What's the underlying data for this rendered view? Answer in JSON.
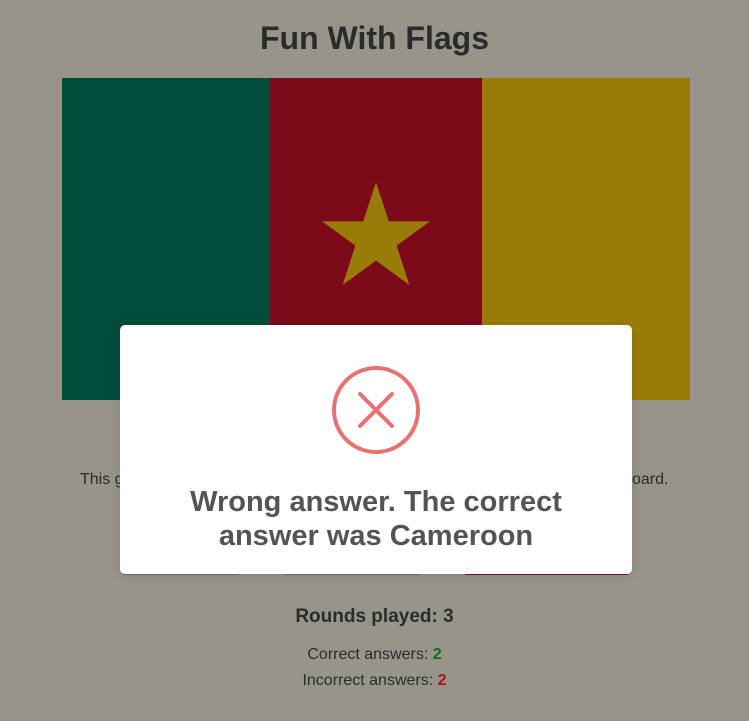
{
  "app": {
    "title": "Fun With Flags"
  },
  "flag": {
    "country": "Cameroon",
    "colors": {
      "green": "#004b3a",
      "red": "#7c0a18",
      "yellow": "#997b0a",
      "star": "#997b0a"
    }
  },
  "description": {
    "start": "This g",
    "end": "oard."
  },
  "choices": [
    {
      "label": "",
      "underline": "#6e6c63"
    },
    {
      "label": "",
      "underline": "#6e6c63"
    },
    {
      "label": "",
      "underline": "#8a0a18"
    }
  ],
  "stats": {
    "rounds_label": "Rounds played:",
    "rounds_value": "3",
    "correct_label": "Correct answers:",
    "correct_value": "2",
    "incorrect_label": "Incorrect answers:",
    "incorrect_value": "2",
    "colors": {
      "correct": "#0a6b1a",
      "incorrect": "#b0101a"
    }
  },
  "modal": {
    "icon": "error-x-circle-icon",
    "message": "Wrong answer. The correct answer was Cameroon",
    "icon_color": "#e57373"
  }
}
